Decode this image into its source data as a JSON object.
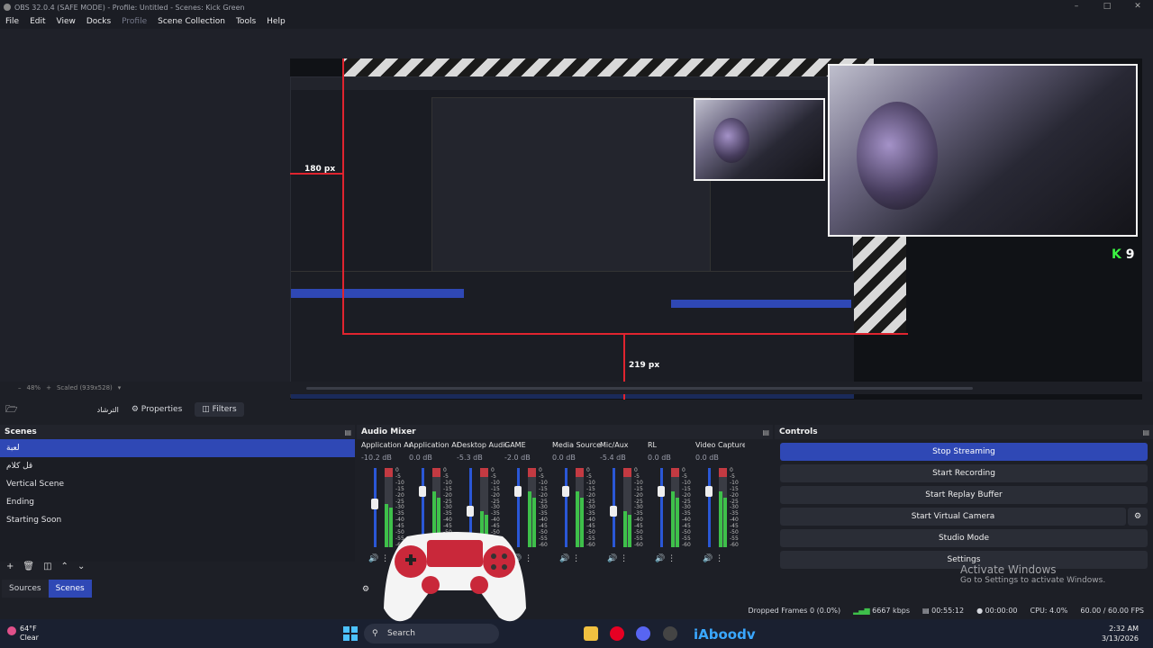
{
  "window": {
    "title": "OBS 32.0.4 (SAFE MODE) - Profile: Untitled - Scenes: Kick Green"
  },
  "menu": [
    "File",
    "Edit",
    "View",
    "Docks",
    "Profile",
    "Scene Collection",
    "Tools",
    "Help"
  ],
  "preview": {
    "dim_left": "180 px",
    "dim_bottom": "219 px",
    "kick_count": "9",
    "zoom": "48%",
    "scale_label": "Scaled (939x528)"
  },
  "context_bar": {
    "source_name": "الترشاد",
    "properties_label": "Properties",
    "filters_label": "Filters"
  },
  "scenes": {
    "title": "Scenes",
    "items": [
      "لعبة",
      "قل كلام",
      "Vertical Scene",
      "Ending",
      "Starting Soon"
    ],
    "selected_index": 0,
    "tabs": [
      "Sources",
      "Scenes"
    ]
  },
  "mixer": {
    "title": "Audio Mixer",
    "channels": [
      {
        "name": "Application Audio Capture",
        "db": "-10.2 dB",
        "level": 0.55
      },
      {
        "name": "Application Audio Capture",
        "db": "0.0 dB",
        "level": 0.7
      },
      {
        "name": "Desktop Audio",
        "db": "-5.3 dB",
        "level": 0.45
      },
      {
        "name": "GAME",
        "db": "-2.0 dB",
        "level": 0.7
      },
      {
        "name": "Media Source",
        "db": "0.0 dB",
        "level": 0.7
      },
      {
        "name": "Mic/Aux",
        "db": "-5.4 dB",
        "level": 0.45
      },
      {
        "name": "RL",
        "db": "0.0 dB",
        "level": 0.7
      },
      {
        "name": "Video Capture",
        "db": "0.0 dB",
        "level": 0.7
      }
    ],
    "ticks": [
      "0",
      "-5",
      "-10",
      "-15",
      "-20",
      "-25",
      "-30",
      "-35",
      "-40",
      "-45",
      "-50",
      "-55",
      "-60"
    ]
  },
  "controls": {
    "title": "Controls",
    "buttons": [
      "Stop Streaming",
      "Start Recording",
      "Start Replay Buffer",
      "Start Virtual Camera",
      "Studio Mode",
      "Settings"
    ]
  },
  "status": {
    "dropped": "Dropped Frames 0 (0.0%)",
    "kbps": "6667 kbps",
    "stream_time": "00:55:12",
    "rec_time": "00:00:00",
    "cpu": "CPU: 4.0%",
    "fps": "60.00 / 60.00 FPS"
  },
  "watermark": {
    "line1": "Activate Windows",
    "line2": "Go to Settings to activate Windows."
  },
  "taskbar": {
    "temp": "64°F",
    "weather": "Clear",
    "search_placeholder": "Search",
    "overlay_name": "iAboodv",
    "time": "2:32 AM",
    "date": "3/13/2026"
  }
}
